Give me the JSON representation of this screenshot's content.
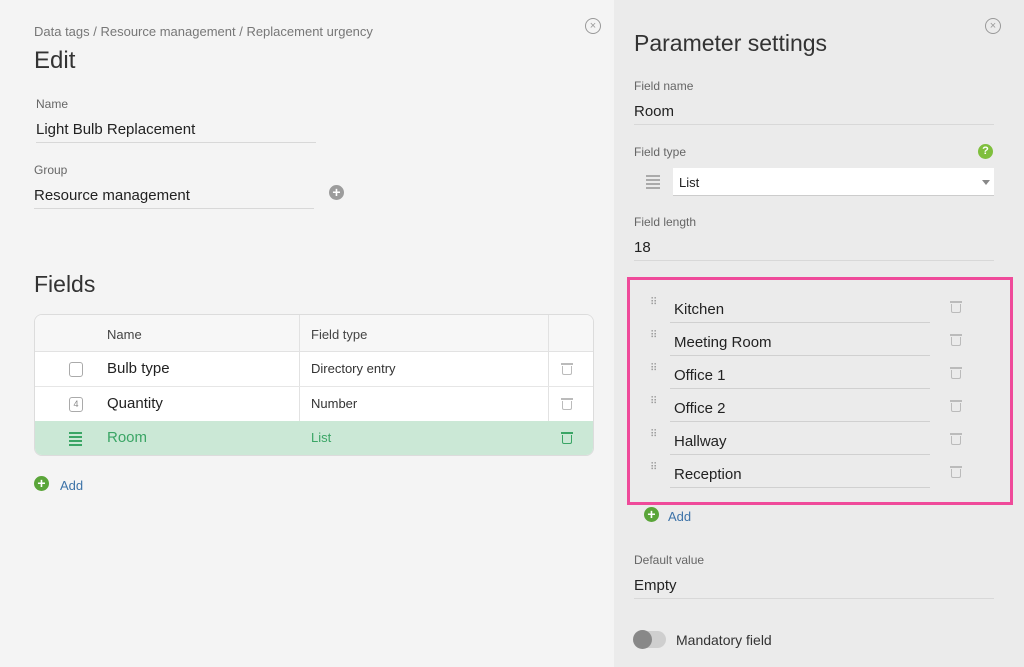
{
  "breadcrumb": "Data tags / Resource management / Replacement urgency",
  "edit": {
    "title": "Edit",
    "name_label": "Name",
    "name_value": "Light Bulb Replacement",
    "group_label": "Group",
    "group_value": "Resource management"
  },
  "fields": {
    "title": "Fields",
    "columns": {
      "name": "Name",
      "type": "Field type"
    },
    "rows": [
      {
        "icon": "document-icon",
        "name": "Bulb type",
        "type": "Directory entry"
      },
      {
        "icon": "number-icon",
        "icon_glyph": "4",
        "name": "Quantity",
        "type": "Number"
      },
      {
        "icon": "list-icon",
        "name": "Room",
        "type": "List"
      }
    ],
    "add_label": "Add"
  },
  "panel": {
    "title": "Parameter settings",
    "field_name_label": "Field name",
    "field_name_value": "Room",
    "field_type_label": "Field type",
    "field_type_value": "List",
    "field_length_label": "Field length",
    "field_length_value": "18",
    "list_items": [
      "Kitchen",
      "Meeting Room",
      "Office 1",
      "Office 2",
      "Hallway",
      "Reception"
    ],
    "add_label": "Add",
    "default_label": "Default value",
    "default_value": "Empty",
    "mandatory_label": "Mandatory field",
    "mandatory_on": false
  },
  "colors": {
    "accent_green": "#5aa539",
    "selected_row": "#cbe8d6",
    "selected_text": "#3aa565",
    "highlight_border": "#ef4a9a",
    "link": "#3d73a8"
  }
}
